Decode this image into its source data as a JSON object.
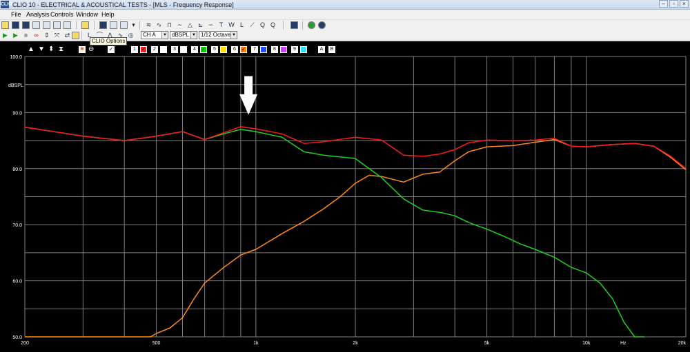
{
  "window": {
    "title": "CLIO 10 - ELECTRICAL & ACOUSTICAL TESTS - [MLS - Frequency Response]",
    "icon_label": "CLIO"
  },
  "menu": [
    "File",
    "Analysis",
    "Controls",
    "Window",
    "Help"
  ],
  "toolbar": {
    "channel_select": "CH A",
    "unit_select": "dBSPL",
    "smoothing_select": "1/12 Octave"
  },
  "tooltip": "CLIO Options",
  "overlay_controls": {
    "curve_numbers": [
      "1",
      "2",
      "3",
      "4",
      "5",
      "6",
      "7",
      "8",
      "9"
    ],
    "curve_colors": [
      "#ff2020",
      "#ffffff",
      "#ffffff",
      "#00d000",
      "#ffdd00",
      "#ff7a00",
      "#2050ff",
      "#d040ff",
      "#30e0ff"
    ],
    "curve_checked": [
      true,
      false,
      false,
      true,
      false,
      true,
      false,
      false,
      false
    ],
    "extra": [
      "A",
      "B"
    ]
  },
  "colors": {
    "background": "#000000",
    "grid": "#7f7f7f",
    "red_trace": "#ff1a1a",
    "green_trace": "#1fd21f",
    "orange_trace": "#ff8c1a",
    "arrow": "#ffffff"
  },
  "chart_data": {
    "type": "line",
    "title": "",
    "xlabel": "Hz",
    "ylabel": "dBSPL",
    "x_scale": "log",
    "xlim": [
      200,
      20000
    ],
    "ylim": [
      50,
      100
    ],
    "grid": true,
    "y_ticks": [
      "100.0",
      "90.0",
      "80.0",
      "70.0",
      "60.0",
      "50.0"
    ],
    "x_ticks": [
      "200",
      "500",
      "1k",
      "2k",
      "5k",
      "10k",
      "20k"
    ],
    "series": [
      {
        "color": "#ff1a1a",
        "x": [
          200,
          300,
          400,
          500,
          600,
          700,
          800,
          900,
          1000,
          1200,
          1400,
          1600,
          2000,
          2400,
          2800,
          3200,
          3600,
          4000,
          4400,
          5000,
          6000,
          7000,
          8000,
          9000,
          10000,
          12000,
          14000,
          16000,
          18000,
          20000
        ],
        "y": [
          87.4,
          85.8,
          85.0,
          85.8,
          86.6,
          85.2,
          86.4,
          87.5,
          87.1,
          86.2,
          84.5,
          84.8,
          85.6,
          85.1,
          82.4,
          82.2,
          82.6,
          83.4,
          84.6,
          85.1,
          85.0,
          85.1,
          85.4,
          84.0,
          83.9,
          84.3,
          84.5,
          84.0,
          82.2,
          80.0
        ]
      },
      {
        "color": "#1fd21f",
        "x": [
          200,
          300,
          400,
          500,
          600,
          700,
          800,
          900,
          1000,
          1200,
          1400,
          1600,
          2000,
          2400,
          2800,
          3200,
          3600,
          4000,
          4400,
          5000,
          5600,
          6300,
          7000,
          8000,
          9000,
          10000,
          11000,
          12000,
          13000,
          14000,
          15000
        ],
        "y": [
          87.4,
          85.8,
          85.0,
          85.8,
          86.6,
          85.2,
          86.2,
          87.0,
          86.6,
          85.6,
          83.0,
          82.4,
          81.8,
          78.4,
          74.6,
          72.6,
          72.2,
          71.6,
          70.4,
          69.2,
          68.0,
          66.6,
          65.6,
          64.2,
          62.4,
          61.4,
          59.6,
          56.8,
          52.6,
          50.0,
          50.0
        ]
      },
      {
        "color": "#ff8c1a",
        "x": [
          200,
          480,
          500,
          550,
          600,
          650,
          700,
          800,
          900,
          1000,
          1200,
          1400,
          1600,
          1800,
          2000,
          2200,
          2400,
          2800,
          3200,
          3600,
          4000,
          4400,
          5000,
          6000,
          7000,
          8000,
          9000,
          10000,
          12000,
          14000,
          16000,
          18000,
          20000
        ],
        "y": [
          50.0,
          50.0,
          50.6,
          51.6,
          53.4,
          56.8,
          59.6,
          62.4,
          64.6,
          65.6,
          68.4,
          70.6,
          72.8,
          75.0,
          77.4,
          78.8,
          78.6,
          77.6,
          79.0,
          79.4,
          81.4,
          83.0,
          83.9,
          84.1,
          84.7,
          85.2,
          84.0,
          83.9,
          84.3,
          84.5,
          84.0,
          82.0,
          79.8
        ]
      }
    ],
    "annotations": [
      {
        "type": "arrow",
        "x": 950,
        "y_top": 96.5,
        "y_bottom": 89.6,
        "direction": "down"
      }
    ]
  }
}
